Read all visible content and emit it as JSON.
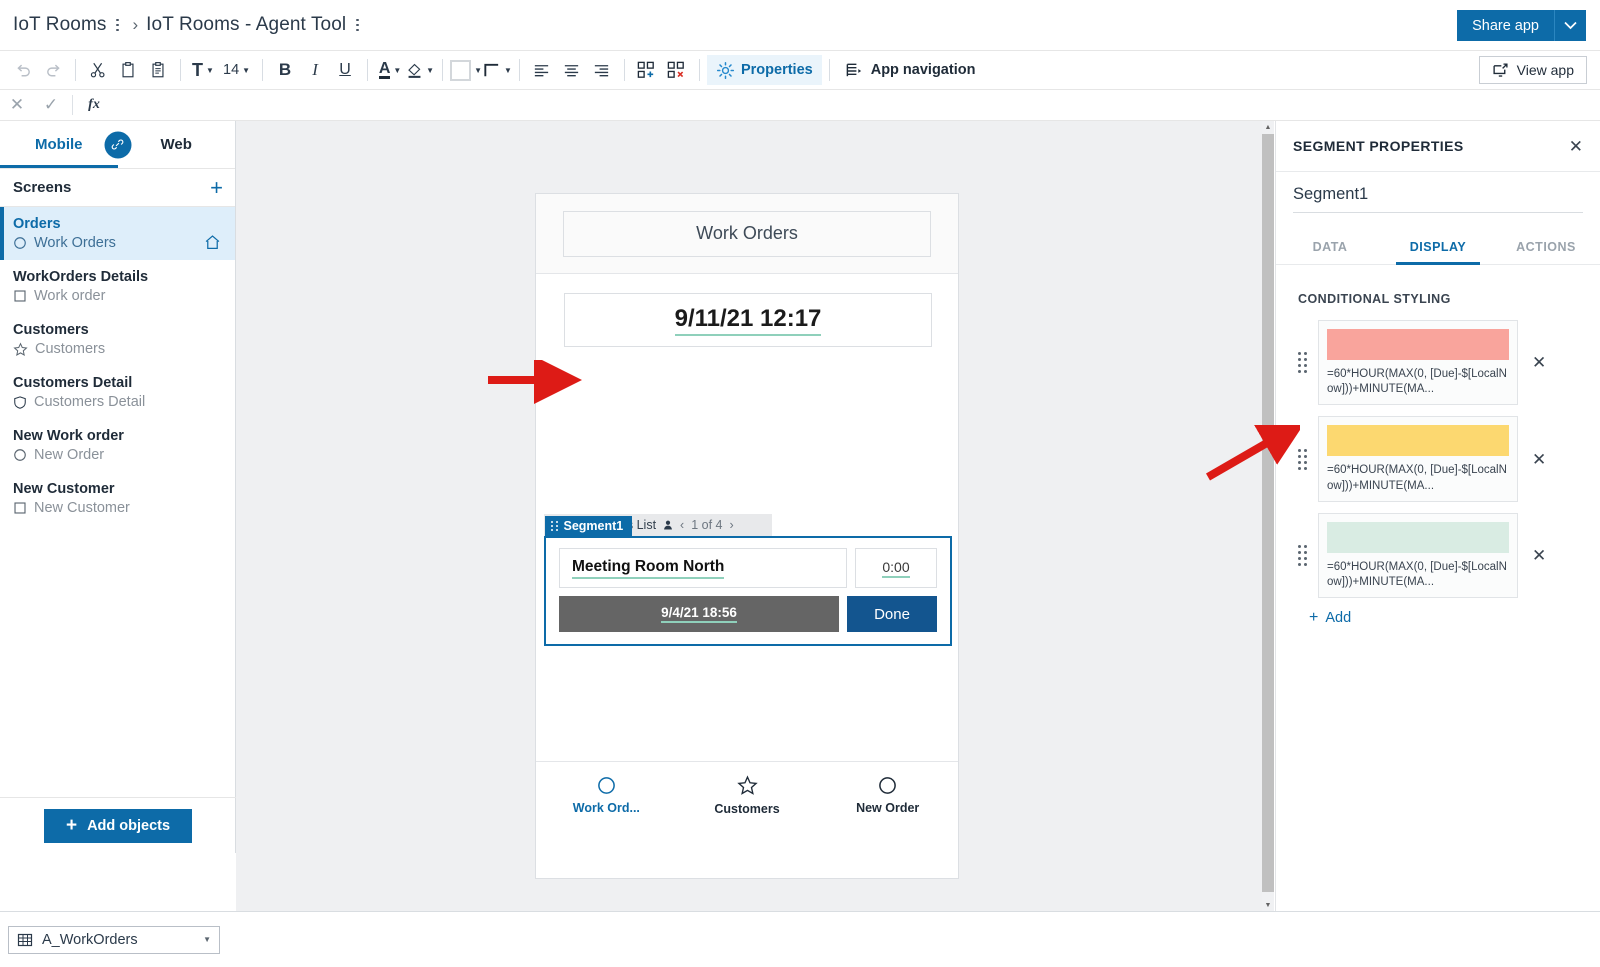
{
  "breadcrumb": {
    "app_name": "IoT Rooms",
    "separator": "›",
    "page_name": "IoT Rooms - Agent Tool"
  },
  "header": {
    "share_label": "Share app",
    "share_caret": "⌄",
    "view_app_label": "View app"
  },
  "toolbar": {
    "undo": "undo-icon",
    "redo": "redo-icon",
    "cut": "scissors-icon",
    "copy": "copy-icon",
    "paste": "paste-icon",
    "font_label": "T",
    "font_size": "14",
    "bold": "B",
    "italic": "I",
    "underline": "U",
    "font_color": "A",
    "fill_color": "fill-bucket-icon",
    "border_color": "border-color-icon",
    "border_style": "border-style-icon",
    "align_left": "align-left-icon",
    "align_center": "align-center-icon",
    "align_right": "align-right-icon",
    "add_component": "add-component-icon",
    "delete_component": "delete-component-icon",
    "properties_label": "Properties",
    "app_navigation_label": "App navigation"
  },
  "formula_bar": {
    "cancel": "✕",
    "accept": "✓",
    "fx": "fx",
    "value": "",
    "placeholder": ""
  },
  "sidebar": {
    "platform_tabs": [
      {
        "label": "Mobile",
        "active": true
      },
      {
        "label": "Web",
        "active": false
      }
    ],
    "link_icon": "link-icon",
    "screens_title": "Screens",
    "add_screen": "+",
    "screens": [
      {
        "name": "Orders",
        "sub": "Work Orders",
        "icon": "circle-icon",
        "active": true,
        "home": true
      },
      {
        "name": "WorkOrders Details",
        "sub": "Work order",
        "icon": "square-icon",
        "active": false,
        "home": false
      },
      {
        "name": "Customers",
        "sub": "Customers",
        "icon": "star-icon",
        "active": false,
        "home": false
      },
      {
        "name": "Customers Detail",
        "sub": "Customers Detail",
        "icon": "shield-icon",
        "active": false,
        "home": false
      },
      {
        "name": "New Work order",
        "sub": "New Order",
        "icon": "circle-icon",
        "active": false,
        "home": false
      },
      {
        "name": "New Customer",
        "sub": "New Customer",
        "icon": "square-icon",
        "active": false,
        "home": false
      }
    ],
    "add_objects_label": "Add objects",
    "add_objects_plus": "+"
  },
  "canvas": {
    "phone_title": "Work Orders",
    "date_value": "9/11/21 12:17",
    "gallery": {
      "label": "Work Orders List",
      "person_icon": "person-icon",
      "prev": "‹",
      "pager": "1 of 4",
      "next": "›"
    },
    "segment_tag": "Segment1",
    "record": {
      "name": "Meeting Room North",
      "elapsed": "0:00",
      "due": "9/4/21 18:56",
      "done_label": "Done"
    },
    "tabbar": [
      {
        "label": "Work Ord...",
        "icon": "circle-icon",
        "active": true
      },
      {
        "label": "Customers",
        "icon": "star-icon",
        "active": false
      },
      {
        "label": "New Order",
        "icon": "circle-icon",
        "active": false
      }
    ]
  },
  "properties_panel": {
    "title": "SEGMENT PROPERTIES",
    "close": "✕",
    "name_value": "Segment1",
    "tabs": [
      {
        "label": "DATA",
        "active": false
      },
      {
        "label": "DISPLAY",
        "active": true
      },
      {
        "label": "ACTIONS",
        "active": false
      }
    ],
    "section_label": "CONDITIONAL STYLING",
    "rules": [
      {
        "color": "#f9a49c",
        "formula": "=60*HOUR(MAX(0, [Due]-$[LocalNow]))+MINUTE(MA...",
        "remove": "✕"
      },
      {
        "color": "#fcd870",
        "formula": "=60*HOUR(MAX(0, [Due]-$[LocalNow]))+MINUTE(MA...",
        "remove": "✕"
      },
      {
        "color": "#d9ece3",
        "formula": "=60*HOUR(MAX(0, [Due]-$[LocalNow]))+MINUTE(MA...",
        "remove": "✕"
      }
    ],
    "add_label": "Add",
    "add_plus": "+"
  },
  "statusbar": {
    "data_source": "A_WorkOrders",
    "table_icon": "table-icon",
    "caret": "▼"
  },
  "colors": {
    "accent": "#0d6ba8",
    "panel_bg": "#eff0f2",
    "selection_blue": "#0d6ba8",
    "annotation_red": "#dd1b16",
    "underline_green": "#8fd0bb"
  }
}
